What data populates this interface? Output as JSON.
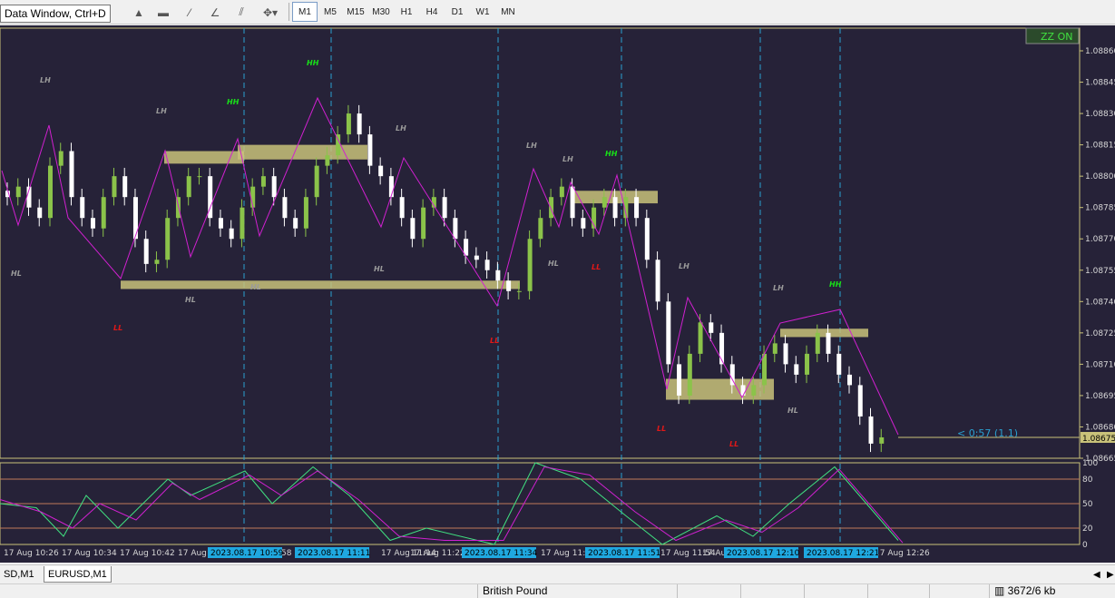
{
  "toolbar": {
    "tooltip": "Data Window, Ctrl+D",
    "timeframes": [
      "M1",
      "M5",
      "M15",
      "M30",
      "H1",
      "H4",
      "D1",
      "W1",
      "MN"
    ],
    "active_timeframe": "M1"
  },
  "chart": {
    "zz_badge": "ZZ ON",
    "countdown": "< 0:57 (1.1)",
    "current_price": "1.08675",
    "price_ticks": [
      "1.08860",
      "1.08845",
      "1.08830",
      "1.08815",
      "1.08800",
      "1.08785",
      "1.08770",
      "1.08755",
      "1.08740",
      "1.08725",
      "1.08710",
      "1.08695",
      "1.08680",
      "1.08665"
    ],
    "osc_ticks": [
      "100",
      "80",
      "50",
      "20",
      "0"
    ],
    "time_labels": [
      "17 Aug 10:26",
      "17 Aug 10:34",
      "17 Aug 10:42",
      "17 Aug",
      "58",
      "17 Aug 11:14",
      "17 Aug 11:22",
      "17 Aug 11:38",
      "17 Aug 11:54",
      "17 Au",
      "17 Aug 12:26"
    ],
    "vline_labels": [
      "2023.08.17 10:59",
      "2023.08.17 11:11",
      "2023.08.17 11:34",
      "2023.08.17 11:51",
      "2023.08.17 12:10",
      "2023.08.17 12:21"
    ],
    "swing_labels": [
      "LH",
      "HH",
      "LH",
      "HH",
      "HL",
      "LL",
      "HL",
      "HL",
      "LH",
      "HL",
      "LL",
      "LH",
      "LH",
      "HH",
      "HL",
      "LL",
      "LH",
      "LL",
      "LL",
      "LH",
      "HH",
      "HL"
    ],
    "colors": {
      "bg": "#262238",
      "bull": "#8bc34a",
      "bear": "#ffffff",
      "zigzag": "#d020d0",
      "zone": "#c9c27a",
      "vline": "#2aa0d0",
      "hh": "#18e018",
      "ll": "#e01818"
    }
  },
  "chart_data": {
    "type": "candlestick",
    "symbol": "EURUSD",
    "timeframe": "M1",
    "price_range": [
      1.08665,
      1.0886
    ],
    "close_approx": [
      1.0879,
      1.08795,
      1.08785,
      1.0878,
      1.08805,
      1.08812,
      1.0879,
      1.0878,
      1.08775,
      1.0879,
      1.088,
      1.0879,
      1.0877,
      1.08758,
      1.0876,
      1.0878,
      1.0879,
      1.088,
      1.088,
      1.0878,
      1.08775,
      1.0877,
      1.08785,
      1.08795,
      1.088,
      1.0879,
      1.0878,
      1.08775,
      1.0879,
      1.08805,
      1.0881,
      1.0882,
      1.0883,
      1.0882,
      1.08805,
      1.088,
      1.0879,
      1.0878,
      1.0877,
      1.08785,
      1.0879,
      1.0878,
      1.0877,
      1.08762,
      1.0876,
      1.08755,
      1.0875,
      1.08745,
      1.08745,
      1.0877,
      1.0878,
      1.0879,
      1.08795,
      1.0878,
      1.08775,
      1.08785,
      1.0879,
      1.0878,
      1.0879,
      1.0878,
      1.0876,
      1.0874,
      1.0871,
      1.08695,
      1.08715,
      1.0873,
      1.08725,
      1.0871,
      1.087,
      1.08695,
      1.087,
      1.08715,
      1.0872,
      1.0871,
      1.08705,
      1.08715,
      1.08725,
      1.08715,
      1.08705,
      1.087,
      1.08685,
      1.08672,
      1.08675
    ],
    "oscillator": {
      "levels": [
        80,
        50,
        20
      ],
      "range": [
        0,
        100
      ]
    },
    "ylabel": "",
    "xlabel": ""
  }
}
